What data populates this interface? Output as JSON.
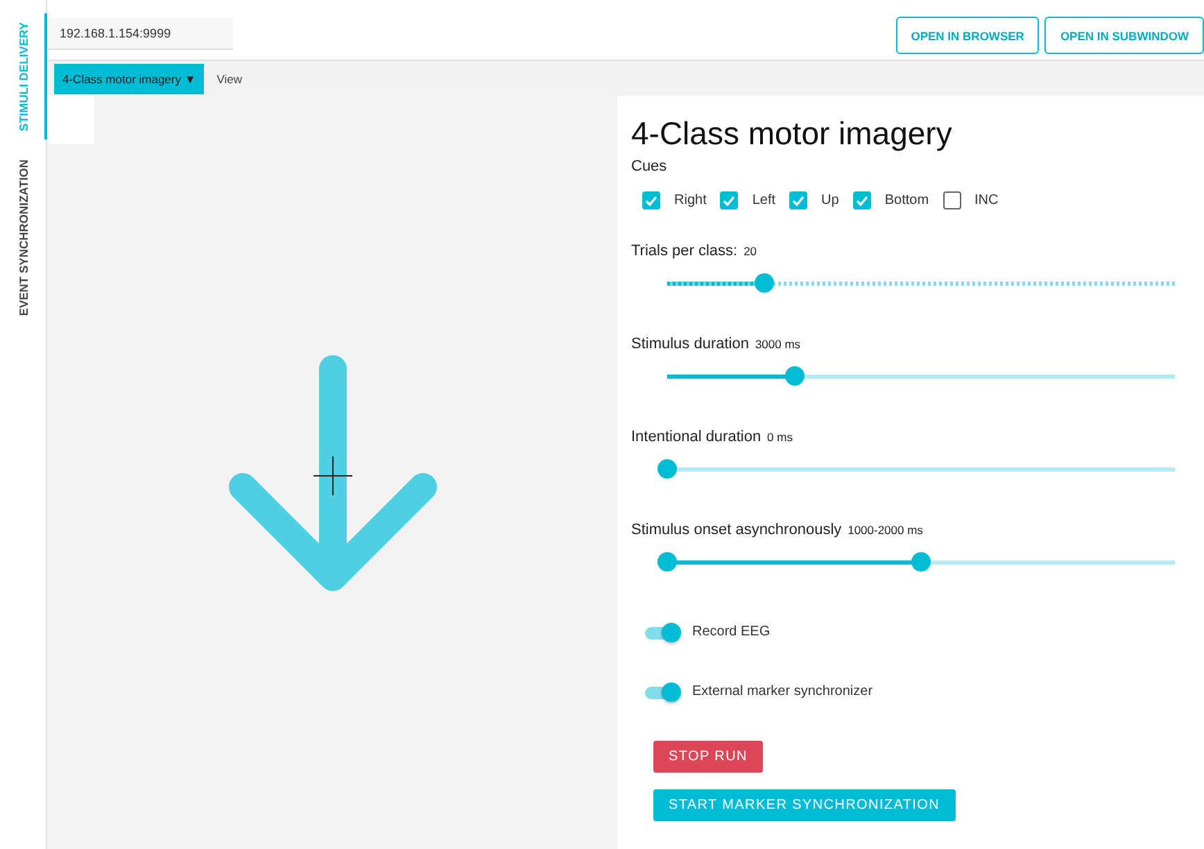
{
  "side_tabs": [
    {
      "label": "STIMULI DELIVERY",
      "selected": true
    },
    {
      "label": "EVENT SYNCHRONIZATION",
      "selected": false
    }
  ],
  "address": {
    "value": "192.168.1.154:9999"
  },
  "top_buttons": [
    "OPEN IN BROWSER",
    "OPEN IN SUBWINDOW"
  ],
  "tabs": [
    {
      "label": "4-Class motor imagery ▼",
      "selected": true
    },
    {
      "label": "View",
      "selected": false
    }
  ],
  "form": {
    "title": "4-Class motor imagery",
    "cues_label": "Cues",
    "cues": [
      {
        "label": "Right",
        "checked": true
      },
      {
        "label": "Left",
        "checked": true
      },
      {
        "label": "Up",
        "checked": true
      },
      {
        "label": "Bottom",
        "checked": true
      },
      {
        "label": "INC",
        "checked": false
      }
    ],
    "sliders": [
      {
        "label": "Trials per class:",
        "reading": "20",
        "kind": "discrete",
        "thumbs": [
          {
            "level": 0.19
          }
        ]
      },
      {
        "label": "Stimulus duration",
        "reading": "3000 ms",
        "kind": "continuous",
        "thumbs": [
          {
            "level": 0.25
          }
        ]
      },
      {
        "label": "Intentional duration",
        "reading": "0 ms",
        "kind": "continuous",
        "thumbs": [
          {
            "level": 0
          }
        ]
      },
      {
        "label": "Stimulus onset asynchronously",
        "reading": "1000-2000 ms",
        "kind": "range",
        "thumbs": [
          {
            "level": 0
          },
          {
            "level": 0.5
          }
        ]
      }
    ],
    "toggles": [
      {
        "label": "Record EEG",
        "on": true
      },
      {
        "label": "External marker synchronizer",
        "on": true
      }
    ],
    "buttons": [
      {
        "label": "STOP RUN",
        "kind": "danger"
      },
      {
        "label": "START MARKER SYNCHRONIZATION",
        "kind": "primary"
      }
    ]
  }
}
